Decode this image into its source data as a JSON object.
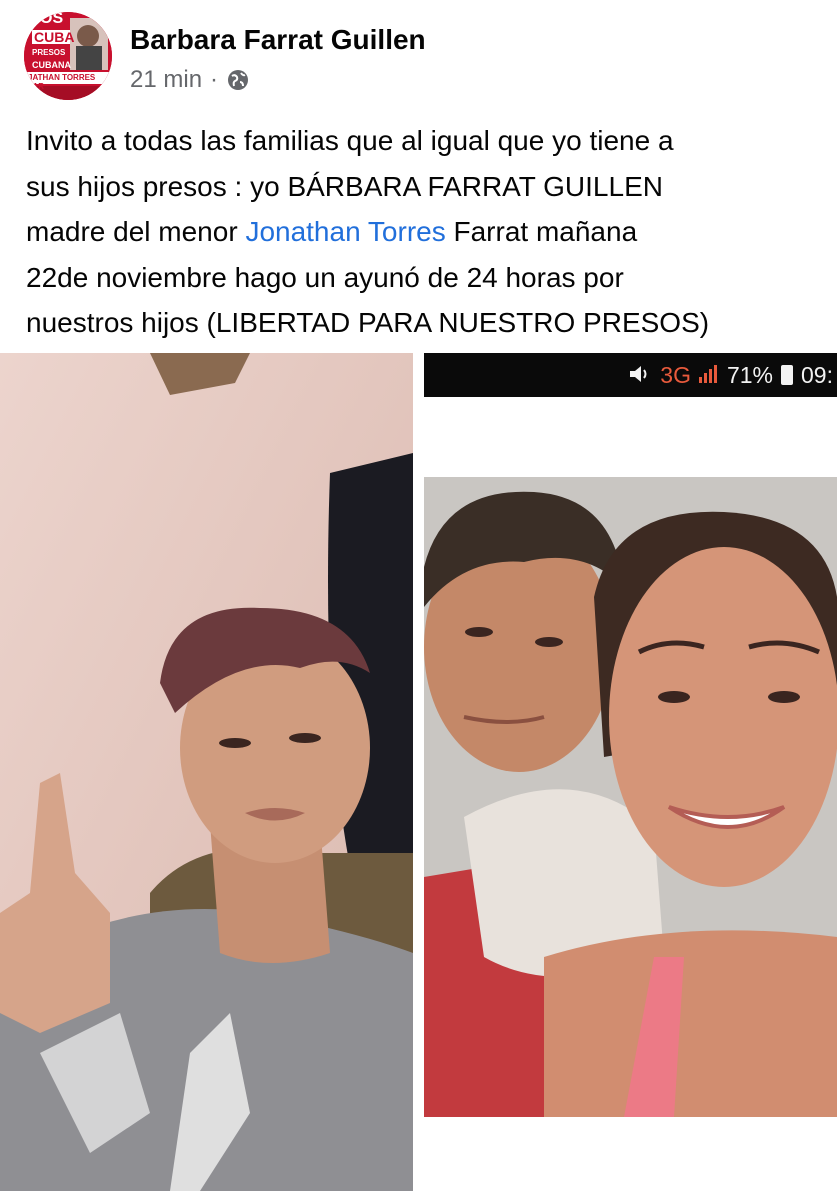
{
  "post": {
    "author": "Barbara Farrat Guillen",
    "time": "21 min",
    "separator": "·",
    "audience_icon": "globe-icon",
    "avatar_text": {
      "top": "OS",
      "mid": "CUBA",
      "badge": "PRESOS",
      "bottom": "CUBANA",
      "banner": "JATHAN TORRES FAR"
    },
    "text_lines": {
      "l1": "Invito a todas las familias que al igual que yo tiene a",
      "l2": "sus hijos presos : yo BÁRBARA FARRAT GUILLEN",
      "l3_pre": "madre del menor ",
      "l3_link": "Jonathan Torres",
      "l3_post": " Farrat mañana",
      "l4": "22de noviembre hago un ayunó de 24 horas por",
      "l5": "nuestros hijos (LIBERTAD PARA NUESTRO PRESOS)"
    }
  },
  "photos": {
    "right_statusbar": {
      "volume_icon": "speaker-icon",
      "network": "3G",
      "network_sup": "3G",
      "battery": "71%",
      "battery_icon": "battery-icon",
      "time": "09:"
    }
  },
  "colors": {
    "link": "#216fdb",
    "meta": "#65676b",
    "avatar_red": "#c8102e"
  }
}
